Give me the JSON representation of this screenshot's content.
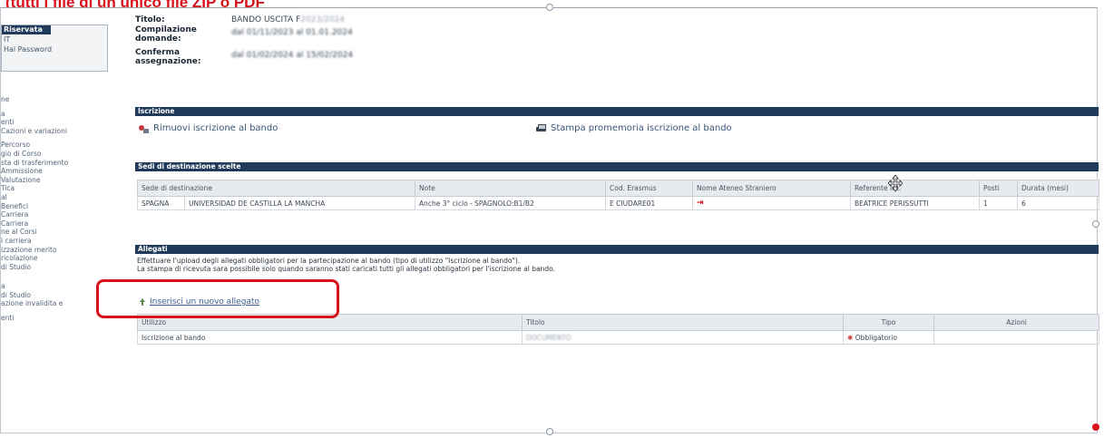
{
  "caption": {
    "text": "(tutti i file di un unico file ",
    "link": "ZIP o PDF"
  },
  "sidebar": {
    "login_title": "Riservata",
    "login_links": [
      "IT",
      "Hai Password"
    ],
    "menu": [
      "",
      "ne",
      "",
      "a",
      "enti",
      "Cazioni e variazioni",
      "",
      "Percorso",
      "gio di Corso",
      "sta di trasferimento",
      "Ammissione",
      "Valutazione",
      "Tica",
      "al",
      "Benefici",
      "Carriera",
      "Carriera",
      "ne al Corsi",
      "i carriera",
      "izzazione merito",
      "ricolazione",
      "di Studio",
      "",
      "",
      "a",
      "di Studio",
      "azione invalidita e",
      "",
      "enti"
    ]
  },
  "info": {
    "titolo_label": "Titolo:",
    "titolo_value": "BANDO USCITA F",
    "titolo_blur": "2023/2024",
    "compilazione_label": [
      "Compilazione",
      "domande:"
    ],
    "compilazione_value": "dal 01/11/2023 al 01.01.2024",
    "conferma_label": [
      "Conferma",
      "assegnazione:"
    ],
    "conferma_value": "dal 01/02/2024 al 15/02/2024"
  },
  "iscrizione": {
    "section_title": "Iscrizione",
    "remove_label": "Rimuovi iscrizione al bando",
    "print_label": "Stampa promemoria iscrizione al bando"
  },
  "sedi": {
    "section_title": "Sedi di destinazione scelte",
    "columns": [
      "Sede di destinazione",
      "Note",
      "Cod. Erasmus",
      "Nome Ateneo Straniero",
      "Referente Int.",
      "Posti",
      "Durata (mesi)"
    ],
    "row": {
      "country": "SPAGNA",
      "university": "UNIVERSIDAD DE CASTILLA LA MANCHA",
      "note": "Anche 3° ciclo - SPAGNOLO:B1/B2",
      "cod": "E CIUDARE01",
      "exit_icon": "⇥",
      "referente": "BEATRICE PERISSUTTI",
      "posti": "1",
      "durata": "6"
    }
  },
  "allegati": {
    "section_title": "Allegati",
    "desc_line1": "Effettuare l'upload degli allegati obbligatori per la partecipazione al bando (tipo di utilizzo \"Iscrizione al bando\").",
    "desc_line2": "La stampa di ricevuta sara possibile solo quando saranno stati caricati tutti gli allegati obbligatori per l'iscrizione al bando.",
    "insert_label": "Inserisci un nuovo allegato",
    "columns": [
      "Utilizzo",
      "Titolo",
      "Tipo",
      "Azioni"
    ],
    "row": {
      "utilizzo": "Iscrizione al bando",
      "titolo": "DOCUMENTO",
      "tipo": "Obbligatorio"
    }
  }
}
